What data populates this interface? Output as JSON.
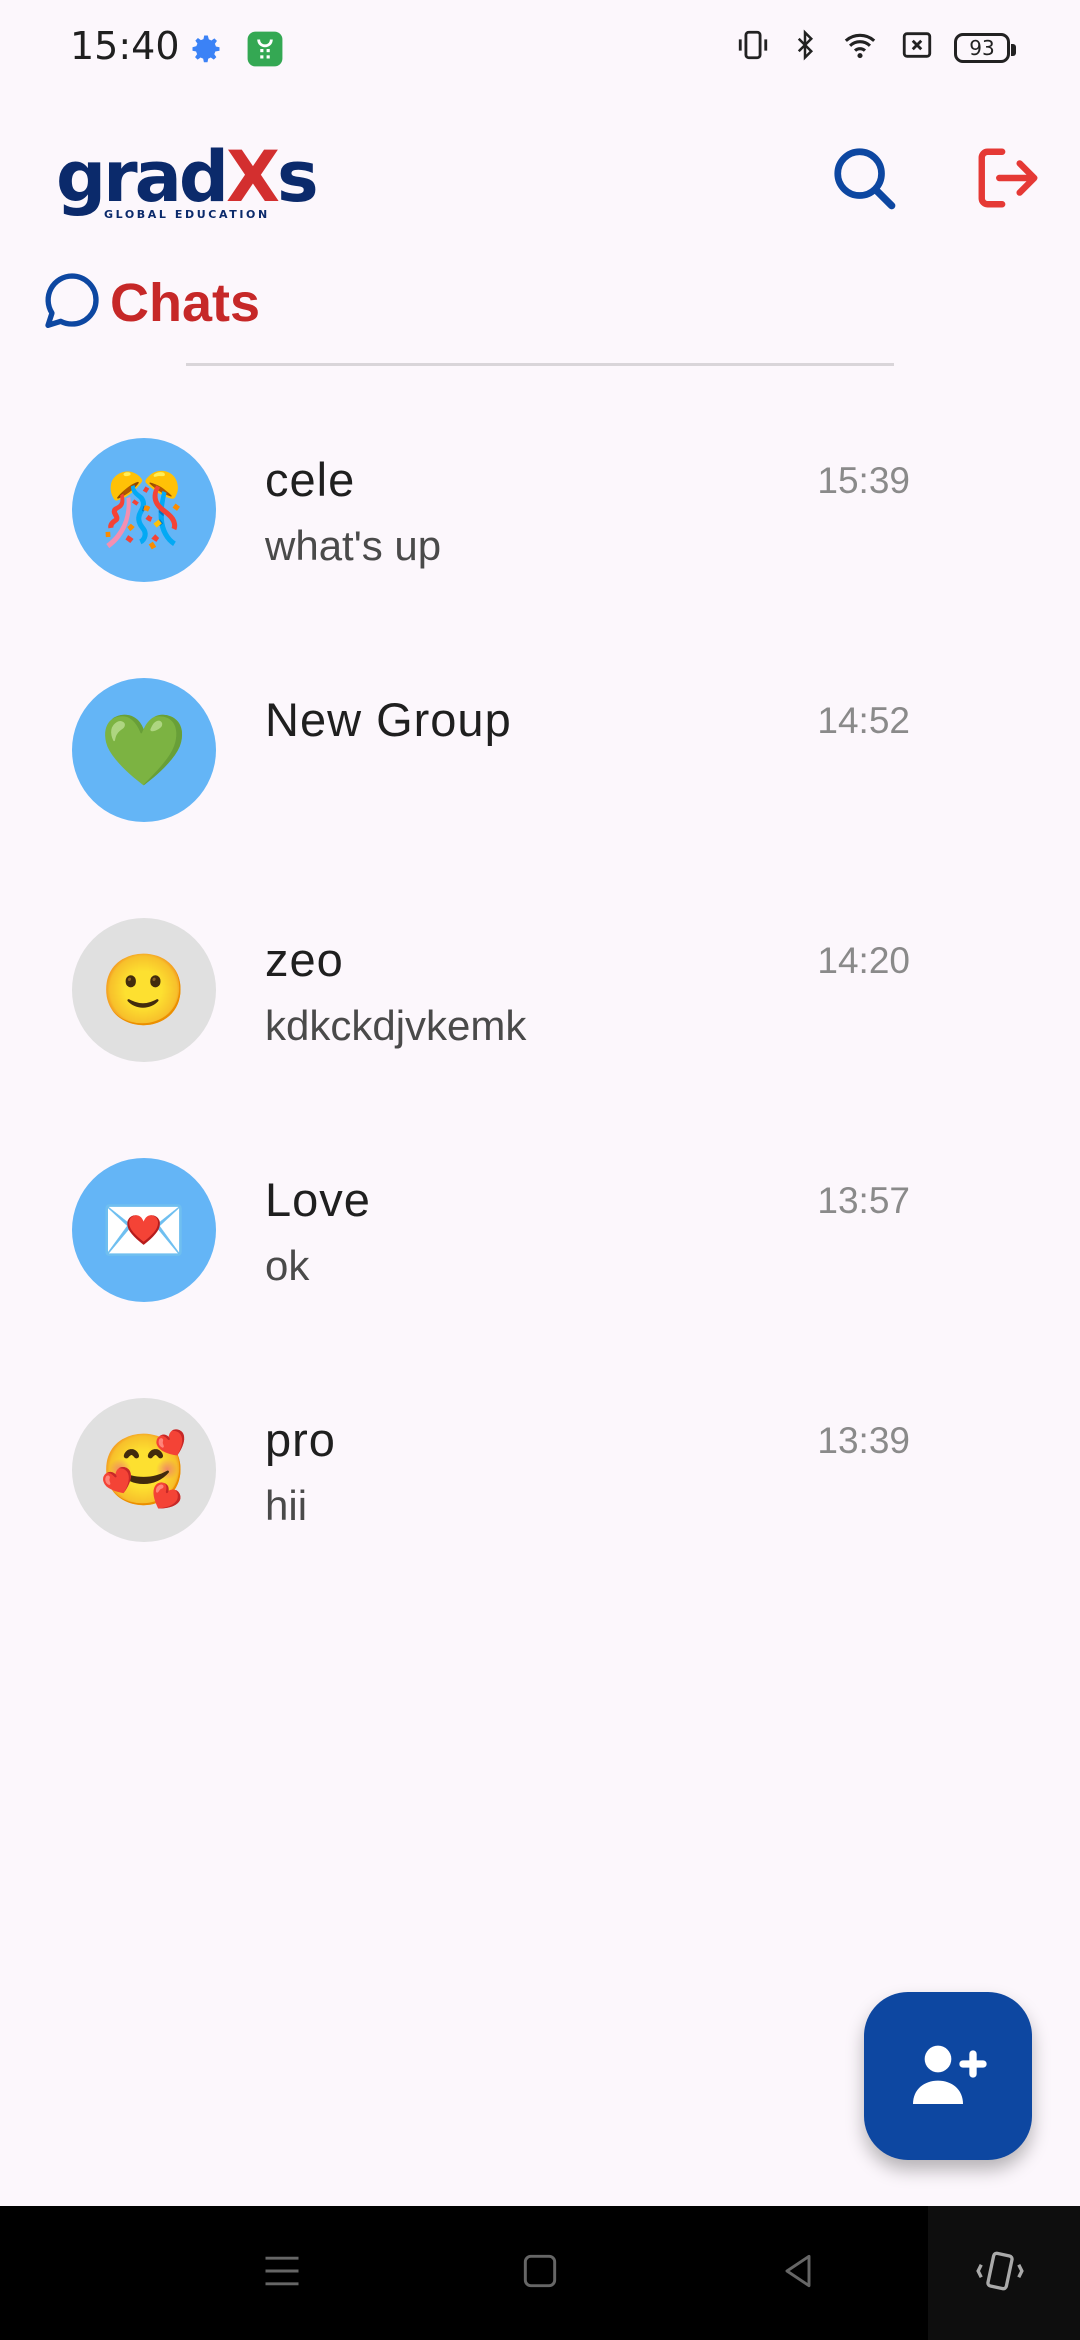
{
  "status_bar": {
    "time": "15:40",
    "left_icons": [
      "gear-icon",
      "app-notification-icon"
    ],
    "right_icons": [
      "vibrate-icon",
      "bluetooth-icon",
      "wifi-icon",
      "sim-off-icon"
    ],
    "battery": "93"
  },
  "header": {
    "logo_main_prefix": "grad",
    "logo_main_x": "X",
    "logo_main_suffix": "s",
    "logo_sub": "GLOBAL EDUCATION",
    "search_icon": "search-icon",
    "logout_icon": "logout-icon"
  },
  "section": {
    "icon": "chat-bubble-icon",
    "title": "Chats"
  },
  "chats": [
    {
      "name": "cele",
      "message": "what's up",
      "time": "15:39",
      "avatar": "🎊",
      "avatar_color": "#64b5f6"
    },
    {
      "name": "New Group",
      "message": "",
      "time": "14:52",
      "avatar": "💚",
      "avatar_color": "#64b5f6"
    },
    {
      "name": "zeo",
      "message": "kdkckdjvkemk",
      "time": "14:20",
      "avatar": "🙂",
      "avatar_color": "#e0e0e0"
    },
    {
      "name": "Love",
      "message": "ok",
      "time": "13:57",
      "avatar": "💌",
      "avatar_color": "#64b5f6"
    },
    {
      "name": "pro",
      "message": "hii",
      "time": "13:39",
      "avatar": "🥰",
      "avatar_color": "#e0e0e0"
    }
  ],
  "fab": {
    "icon": "add-user-icon"
  },
  "nav_bar": {
    "items": [
      "menu-icon",
      "home-icon",
      "back-icon",
      "rotate-icon"
    ]
  },
  "colors": {
    "brand_blue": "#0d47a1",
    "accent_red": "#c62828",
    "background": "#fcf7fc"
  }
}
